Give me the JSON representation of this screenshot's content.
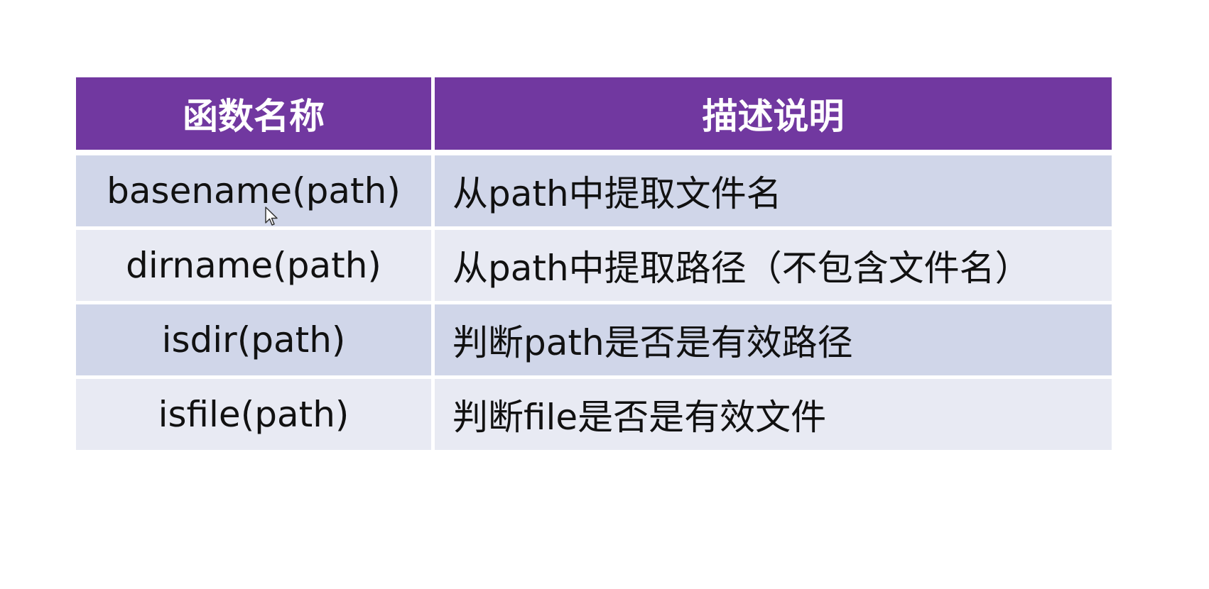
{
  "table": {
    "headers": {
      "name": "函数名称",
      "description": "描述说明"
    },
    "rows": [
      {
        "name": "basename(path)",
        "description": "从path中提取文件名"
      },
      {
        "name": "dirname(path)",
        "description": "从path中提取路径（不包含文件名）"
      },
      {
        "name": "isdir(path)",
        "description": "判断path是否是有效路径"
      },
      {
        "name": "isfile(path)",
        "description": "判断file是否是有效文件"
      }
    ]
  },
  "colors": {
    "header_background": "#7138a0",
    "header_text": "#ffffff",
    "row_odd_background": "#d0d6e9",
    "row_even_background": "#e8eaf3",
    "body_text": "#111111"
  },
  "icons": {
    "cursor": "mouse-pointer-icon"
  }
}
